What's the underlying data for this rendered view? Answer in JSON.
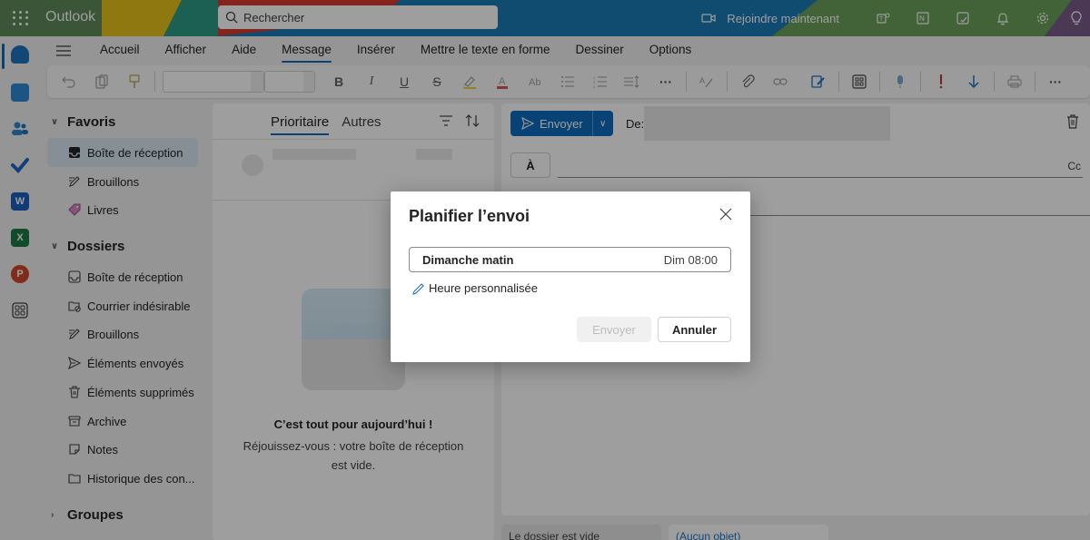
{
  "app": {
    "brand": "Outlook"
  },
  "topbar": {
    "search_placeholder": "Rechercher",
    "join_label": "Rejoindre maintenant",
    "icons": [
      "video-icon",
      "teams-icon",
      "onenote-icon",
      "todo-note-icon",
      "bell-icon",
      "gear-icon",
      "lightbulb-icon"
    ]
  },
  "rail": {
    "apps": [
      "mail",
      "calendar",
      "people",
      "todo",
      "word",
      "excel",
      "powerpoint",
      "more-apps"
    ]
  },
  "ribbon": {
    "tabs": [
      {
        "label": "Accueil"
      },
      {
        "label": "Afficher"
      },
      {
        "label": "Aide"
      },
      {
        "label": "Message",
        "active": true
      },
      {
        "label": "Insérer"
      },
      {
        "label": "Mettre le texte en forme"
      },
      {
        "label": "Dessiner"
      },
      {
        "label": "Options"
      }
    ],
    "toolbar": {
      "font_name": "",
      "font_size": "",
      "bold": "B",
      "italic": "I",
      "underline": "U",
      "strike": "S",
      "more": "···"
    }
  },
  "folders": {
    "favorites_label": "Favoris",
    "favorites": [
      {
        "label": "Boîte de réception",
        "icon": "inbox-icon",
        "selected": true
      },
      {
        "label": "Brouillons",
        "icon": "draft-icon"
      },
      {
        "label": "Livres",
        "icon": "tag-icon"
      }
    ],
    "folders_label": "Dossiers",
    "folders": [
      {
        "label": "Boîte de réception",
        "icon": "inbox-icon"
      },
      {
        "label": "Courrier indésirable",
        "icon": "junk-icon"
      },
      {
        "label": "Brouillons",
        "icon": "draft-icon"
      },
      {
        "label": "Éléments envoyés",
        "icon": "send-icon"
      },
      {
        "label": "Éléments supprimés",
        "icon": "trash-icon"
      },
      {
        "label": "Archive",
        "icon": "archive-icon"
      },
      {
        "label": "Notes",
        "icon": "note-icon"
      },
      {
        "label": "Historique des con...",
        "icon": "folder-icon"
      }
    ],
    "groups_label": "Groupes"
  },
  "message_list": {
    "tabs": [
      {
        "label": "Prioritaire",
        "active": true
      },
      {
        "label": "Autres"
      }
    ],
    "empty_title": "C’est tout pour aujourd’hui !",
    "empty_subtitle": "Réjouissez-vous : votre boîte de réception est vide."
  },
  "compose": {
    "send_label": "Envoyer",
    "from_label": "De:",
    "from_value": "",
    "to_label": "À",
    "cc_label": "Cc",
    "footer_tabs": [
      "Le dossier est vide",
      "(Aucun objet)"
    ]
  },
  "dialog": {
    "title": "Planifier l’envoi",
    "option_name": "Dimanche matin",
    "option_time": "Dim 08:00",
    "custom_label": "Heure personnalisée",
    "send_label": "Envoyer",
    "cancel_label": "Annuler"
  },
  "colors": {
    "accent": "#0f6cbd",
    "selected_folder": "#d9e6f2"
  }
}
